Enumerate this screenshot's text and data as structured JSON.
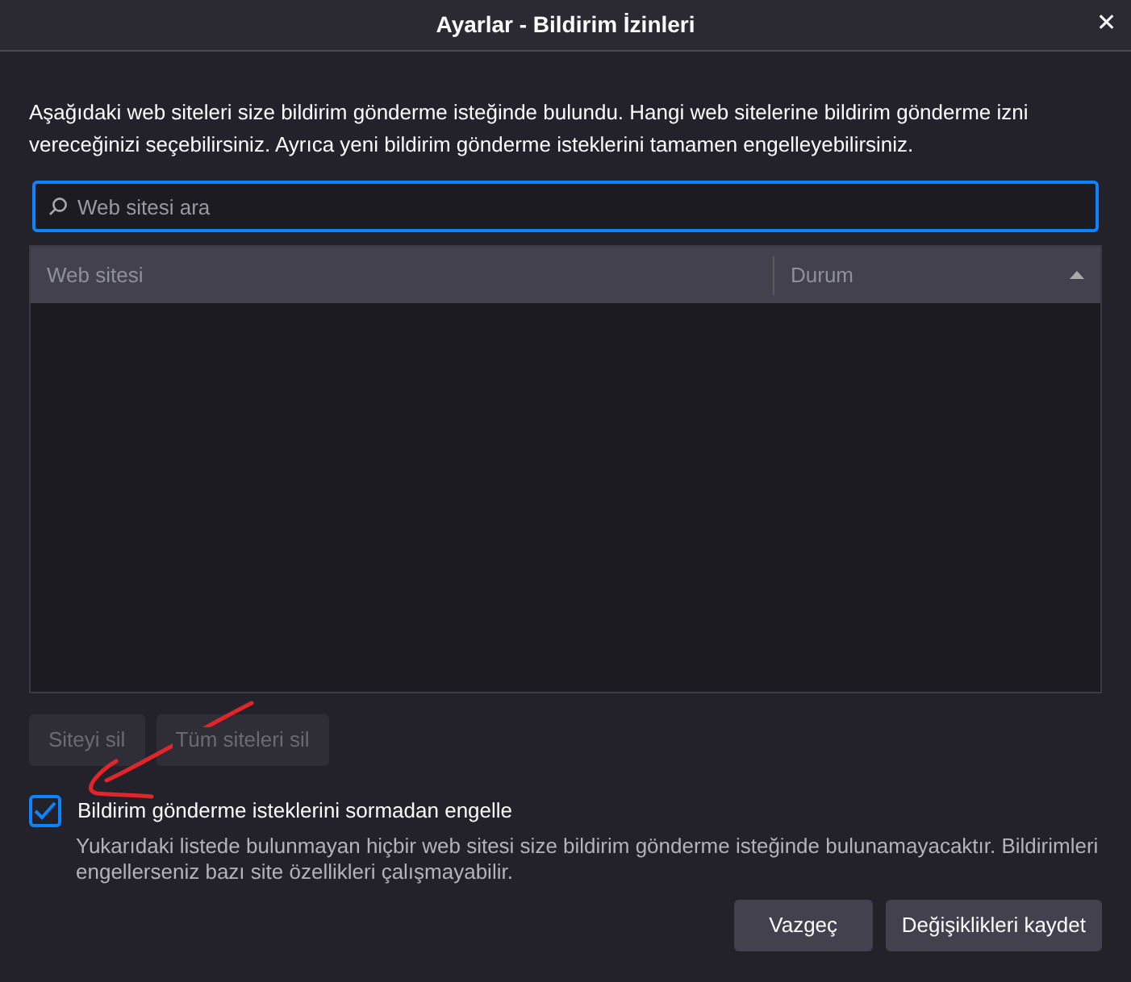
{
  "window": {
    "title": "Ayarlar - Bildirim İzinleri",
    "close": "✕"
  },
  "description": "Aşağıdaki web siteleri size bildirim gönderme isteğinde bulundu. Hangi web sitelerine bildirim gönderme izni vereceğinizi seçebilirsiniz. Ayrıca yeni bildirim gönderme isteklerini tamamen engelleyebilirsiniz.",
  "search": {
    "placeholder": "Web sitesi ara"
  },
  "table": {
    "columns": [
      {
        "label": "Web sitesi",
        "sorted": false
      },
      {
        "label": "Durum",
        "sorted": true
      }
    ]
  },
  "site_buttons": [
    {
      "label": "Siteyi sil",
      "disabled": true
    },
    {
      "label": "Tüm siteleri sil",
      "disabled": true
    }
  ],
  "block_option": {
    "label": "Bildirim gönderme isteklerini sormadan engelle",
    "checked": true,
    "note": "Yukarıdaki listede bulunmayan hiçbir web sitesi size bildirim gönderme isteğinde bulunamayacaktır. Bildirimleri engellerseniz bazı site özellikleri çalışmayabilir."
  },
  "footer_buttons": [
    {
      "label": "Vazgeç"
    },
    {
      "label": "Değişiklikleri kaydet"
    }
  ]
}
